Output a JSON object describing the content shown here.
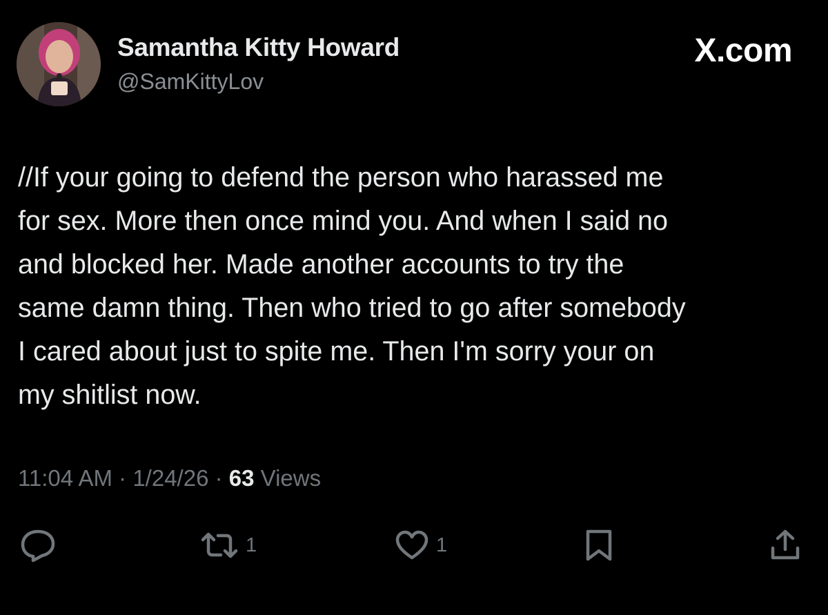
{
  "author": {
    "name": "Samantha Kitty Howard",
    "handle": "@SamKittyLov",
    "avatar_icon": "profile-photo"
  },
  "brand": {
    "label": "X.com"
  },
  "tweet": {
    "text": "//If your going to defend the person who harassed me\nfor sex. More then once mind you. And when I said no\nand blocked her. Made another accounts to try the\nsame damn thing. Then who tried to go after somebody\nI cared about just to spite me. Then I'm sorry your on\nmy shitlist now."
  },
  "meta": {
    "time": "11:04 AM",
    "date": "1/24/26",
    "views_count": "63",
    "views_label": "Views"
  },
  "actions": {
    "reply": {
      "icon": "reply-icon"
    },
    "repost": {
      "icon": "repost-icon",
      "count": "1"
    },
    "like": {
      "icon": "heart-icon",
      "count": "1"
    },
    "bookmark": {
      "icon": "bookmark-icon"
    },
    "share": {
      "icon": "share-icon"
    }
  },
  "colors": {
    "background": "#000000",
    "text_primary": "#e7e9ea",
    "text_secondary": "#71767b"
  }
}
